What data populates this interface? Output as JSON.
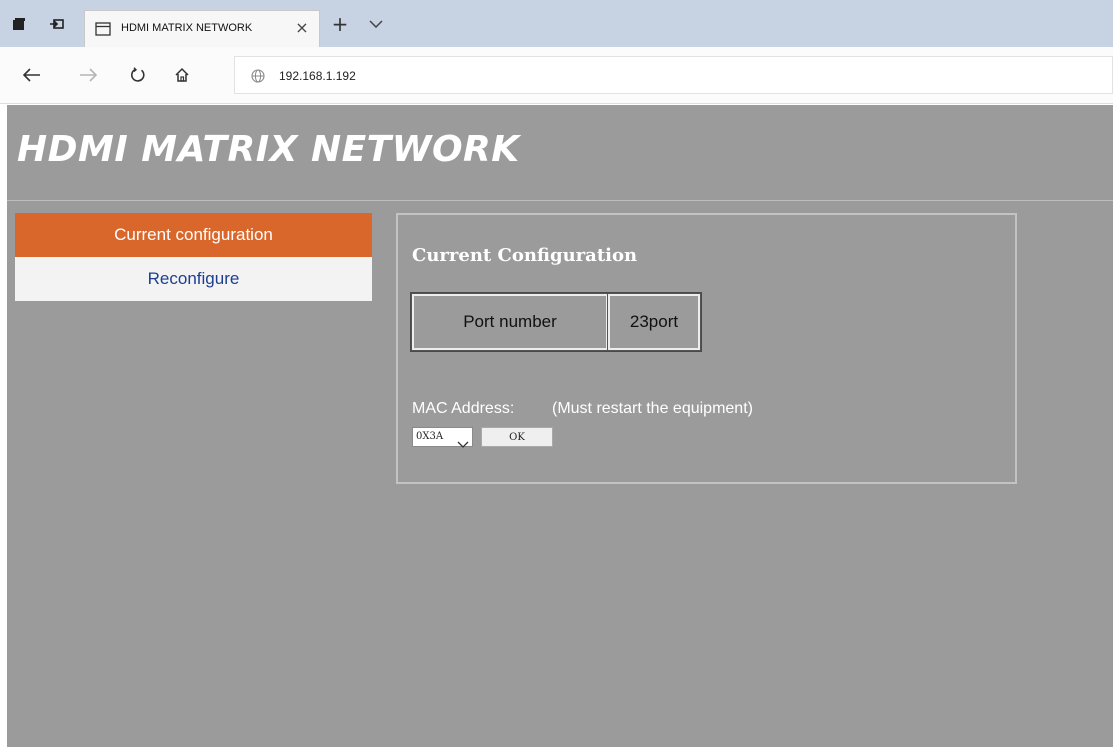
{
  "browser": {
    "tab": {
      "title": "HDMI MATRIX NETWORK",
      "close": "×"
    },
    "new_tab": "+",
    "address": {
      "url": "192.168.1.192"
    }
  },
  "page": {
    "title": "HDMI MATRIX NETWORK",
    "menu": [
      {
        "label": "Current configuration",
        "active": true
      },
      {
        "label": "Reconfigure",
        "active": false
      }
    ],
    "panel": {
      "heading": "Current Configuration",
      "port_table": {
        "label": "Port number",
        "value": "23port"
      },
      "mac": {
        "label": "MAC Address:",
        "note": "(Must restart the equipment)",
        "selected": "0X3A",
        "ok_label": "OK"
      }
    }
  },
  "colors": {
    "menu_active": "#d9662a",
    "menu_link": "#1d3f8f",
    "page_background": "#9b9b9b",
    "tabbar": "#c7d3e3"
  },
  "icons": [
    "tab-actions-icon",
    "tab-switch-icon",
    "page-icon",
    "close-icon",
    "plus-icon",
    "chevron-down-icon",
    "back-icon",
    "forward-icon",
    "refresh-icon",
    "home-icon",
    "globe-icon"
  ]
}
